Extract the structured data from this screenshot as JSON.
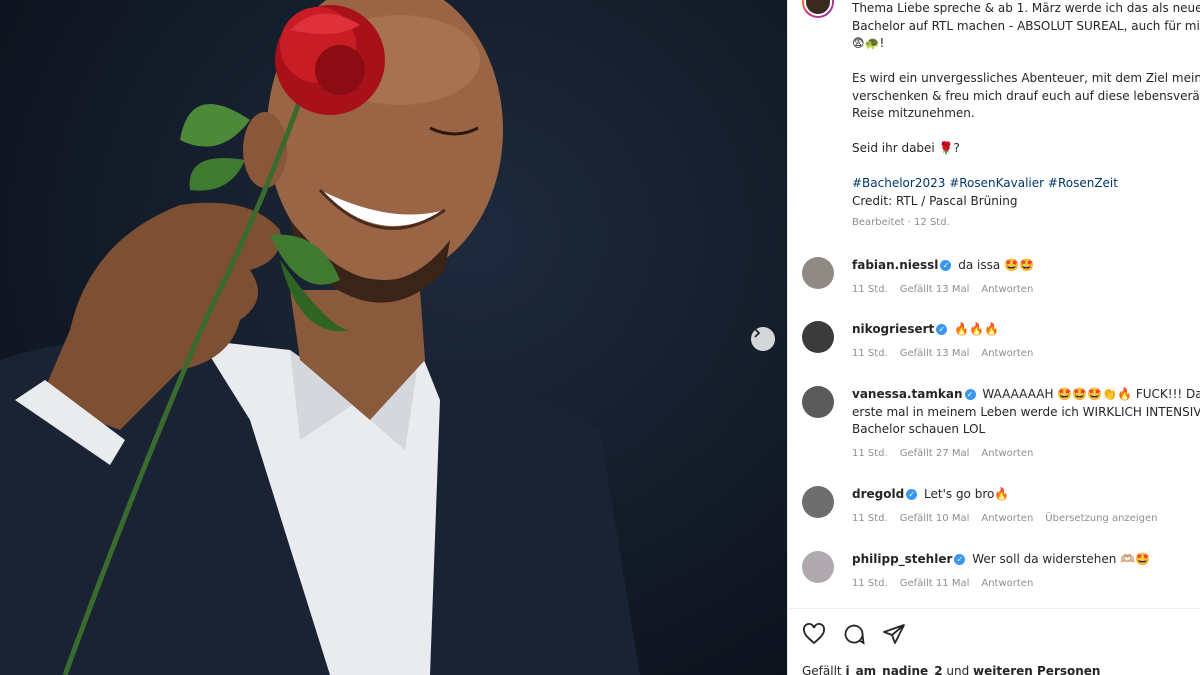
{
  "post": {
    "caption_lines": [
      "Thema Liebe spreche & ab 1. März werde ich das als neue",
      "Bachelor auf RTL machen - ABSOLUT SUREAL, auch für mi",
      "😨🐢!",
      "",
      "Es wird ein unvergessliches Abenteuer, mit dem Ziel mein",
      "verschenken & freu mich drauf euch auf diese lebensverä",
      "Reise mitzunehmen.",
      "",
      "Seid ihr dabei 🌹?"
    ],
    "hashtags": "#Bachelor2023 #RosenKavalier #RosenZeit",
    "credit": "Credit: RTL / Pascal Brüning",
    "edited_meta": "Bearbeitet · 12 Std."
  },
  "comments": [
    {
      "user": "fabian.niessl",
      "text": "da issa 🤩🤩",
      "time": "11 Std.",
      "likes": "Gefällt 13 Mal",
      "reply": "Antworten",
      "extra": ""
    },
    {
      "user": "nikogriesert",
      "text": "🔥🔥🔥",
      "time": "11 Std.",
      "likes": "Gefällt 13 Mal",
      "reply": "Antworten",
      "extra": ""
    },
    {
      "user": "vanessa.tamkan",
      "text": "WAAAAAAH 🤩🤩🤩👏🔥 FUCK!!! Da erste mal in meinem Leben werde ich WIRKLICH INTENSIV Bachelor schauen LOL",
      "time": "11 Std.",
      "likes": "Gefällt 27 Mal",
      "reply": "Antworten",
      "extra": ""
    },
    {
      "user": "dregold",
      "text": "Let's go bro🔥",
      "time": "11 Std.",
      "likes": "Gefällt 10 Mal",
      "reply": "Antworten",
      "extra": "Übersetzung anzeigen"
    },
    {
      "user": "philipp_stehler",
      "text": "Wer soll da widerstehen 🫶🏼🤩",
      "time": "11 Std.",
      "likes": "Gefällt 11 Mal",
      "reply": "Antworten",
      "extra": ""
    }
  ],
  "likes_line": {
    "prefix": "Gefällt ",
    "user": "i_am_nadine_2",
    "middle": " und ",
    "rest": "weiteren Personen"
  },
  "icons": [
    "heart-icon",
    "comment-icon",
    "share-icon",
    "chevron-right-icon",
    "verified-icon"
  ],
  "colors": {
    "accent": "#3897f0",
    "hashtag": "#00376b",
    "meta": "#8e8e8e",
    "photo_bg": "#131b28",
    "rose": "#c0141c"
  }
}
